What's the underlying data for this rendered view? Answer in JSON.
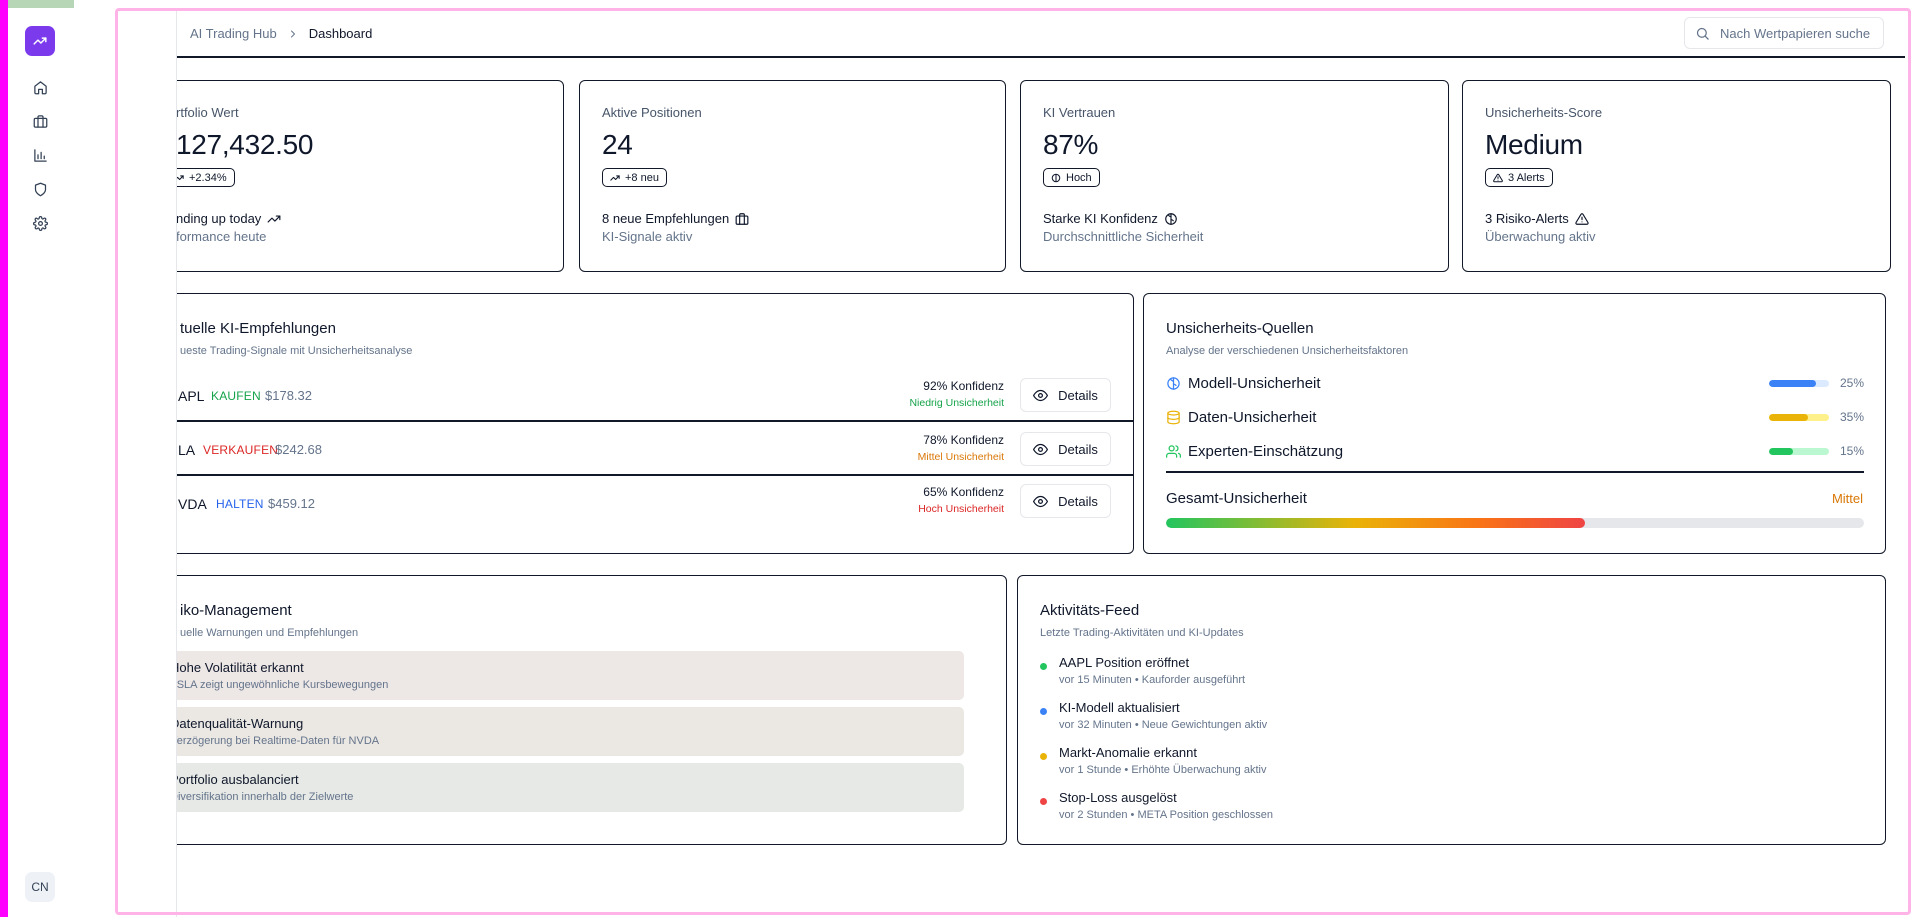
{
  "app": {
    "cn_badge": "CN"
  },
  "sidebar": {
    "items": [
      {
        "name": "home-icon"
      },
      {
        "name": "briefcase-icon"
      },
      {
        "name": "bar-chart-icon"
      },
      {
        "name": "shield-icon"
      },
      {
        "name": "settings-icon"
      }
    ]
  },
  "header": {
    "breadcrumb": [
      "AI Trading Hub",
      "Dashboard"
    ],
    "search_placeholder": "Nach Wertpapieren suche"
  },
  "stats": [
    {
      "label": "rtfolio Wert",
      "value": "127,432.50",
      "badge": "+2.34%",
      "foot": "nding up today",
      "sub": "formance heute"
    },
    {
      "label": "Aktive Positionen",
      "value": "24",
      "badge": "+8 neu",
      "foot": "8 neue Empfehlungen",
      "sub": "KI-Signale aktiv"
    },
    {
      "label": "KI Vertrauen",
      "value": "87%",
      "badge": "Hoch",
      "foot": "Starke KI Konfidenz",
      "sub": "Durchschnittliche Sicherheit"
    },
    {
      "label": "Unsicherheits-Score",
      "value": "Medium",
      "badge": "3 Alerts",
      "foot": "3 Risiko-Alerts",
      "sub": "Überwachung aktiv"
    }
  ],
  "recommendations": {
    "title": "tuelle KI-Empfehlungen",
    "desc": "ueste Trading-Signale mit Unsicherheitsanalyse",
    "details_label": "Details",
    "rows": [
      {
        "symbol": "APL",
        "action": "KAUFEN",
        "action_color": "#16a34a",
        "price": "$178.32",
        "confidence": "92% Konfidenz",
        "uncertainty": "Niedrig Unsicherheit",
        "unc_color": "#16a34a"
      },
      {
        "symbol": "LA",
        "action": "VERKAUFEN",
        "action_color": "#dc2626",
        "price": "$242.68",
        "confidence": "78% Konfidenz",
        "uncertainty": "Mittel Unsicherheit",
        "unc_color": "#d97706"
      },
      {
        "symbol": "VDA",
        "action": "HALTEN",
        "action_color": "#2563eb",
        "price": "$459.12",
        "confidence": "65% Konfidenz",
        "uncertainty": "Hoch Unsicherheit",
        "unc_color": "#dc2626"
      }
    ]
  },
  "uncertainty_sources": {
    "title": "Unsicherheits-Quellen",
    "desc": "Analyse der verschiedenen Unsicherheitsfaktoren",
    "items": [
      {
        "label": "Modell-Unsicherheit",
        "percent": "25%",
        "fill_fraction": 0.78,
        "color": "#3b82f6",
        "track": "#dbeafe",
        "icon": "brain-icon"
      },
      {
        "label": "Daten-Unsicherheit",
        "percent": "35%",
        "fill_fraction": 0.65,
        "color": "#eab308",
        "track": "#fef08a",
        "icon": "database-icon"
      },
      {
        "label": "Experten-Einschätzung",
        "percent": "15%",
        "fill_fraction": 0.4,
        "color": "#22c55e",
        "track": "#bbf7d0",
        "icon": "users-icon"
      }
    ],
    "total_label": "Gesamt-Unsicherheit",
    "total_value": "Mittel",
    "total_fill_fraction": 0.6
  },
  "risk": {
    "title": "iko-Management",
    "desc": "uelle Warnungen und Empfehlungen",
    "alerts": [
      {
        "title": "Hohe Volatilität erkannt",
        "sub": "TSLA zeigt ungewöhnliche Kursbewegungen",
        "bg": "#ede7e6",
        "color": "#dc2626"
      },
      {
        "title": "Datenqualität-Warnung",
        "sub": "Verzögerung bei Realtime-Daten für NVDA",
        "bg": "#ebe8e4",
        "color": "#eab308"
      },
      {
        "title": "Portfolio ausbalanciert",
        "sub": "Diversifikation innerhalb der Zielwerte",
        "bg": "#e6e9e6",
        "color": "#16a34a"
      }
    ]
  },
  "feed": {
    "title": "Aktivitäts-Feed",
    "desc": "Letzte Trading-Aktivitäten und KI-Updates",
    "items": [
      {
        "title": "AAPL Position eröffnet",
        "sub": "vor 15 Minuten • Kauforder ausgeführt",
        "color": "#22c55e"
      },
      {
        "title": "KI-Modell aktualisiert",
        "sub": "vor 32 Minuten • Neue Gewichtungen aktiv",
        "color": "#3b82f6"
      },
      {
        "title": "Markt-Anomalie erkannt",
        "sub": "vor 1 Stunde • Erhöhte Überwachung aktiv",
        "color": "#eab308"
      },
      {
        "title": "Stop-Loss ausgelöst",
        "sub": "vor 2 Stunden • META Position geschlossen",
        "color": "#ef4444"
      }
    ]
  }
}
